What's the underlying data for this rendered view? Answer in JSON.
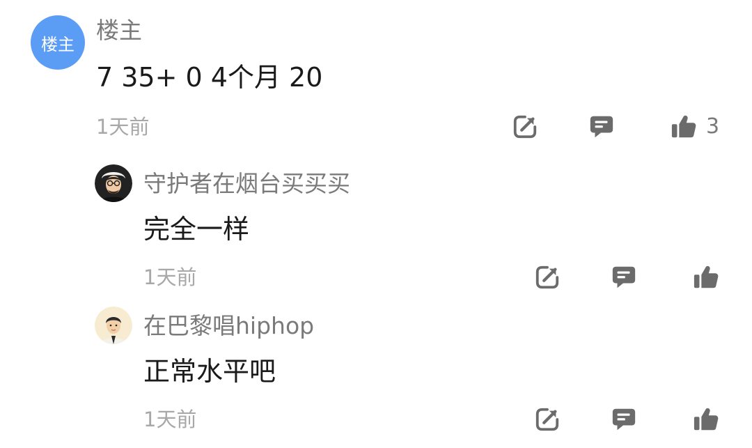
{
  "main_comment": {
    "avatar_label": "楼主",
    "author": "楼主",
    "content": "7 35+ 0 4个月  20",
    "time": "1天前",
    "like_count": "3",
    "icons": [
      "share-icon",
      "comment-icon",
      "thumbs-up-icon"
    ]
  },
  "replies": [
    {
      "author": "守护者在烟台买买买",
      "content": "完全一样",
      "time": "1天前"
    },
    {
      "author": "在巴黎唱hiphop",
      "content": "正常水平吧",
      "time": "1天前"
    }
  ],
  "colors": {
    "owner_avatar_bg": "#5b9cf5",
    "icon_gray": "#6b6b6b",
    "name_gray": "#7a7a7a",
    "time_gray": "#a8a8a8",
    "content_black": "#1a1a1a"
  }
}
